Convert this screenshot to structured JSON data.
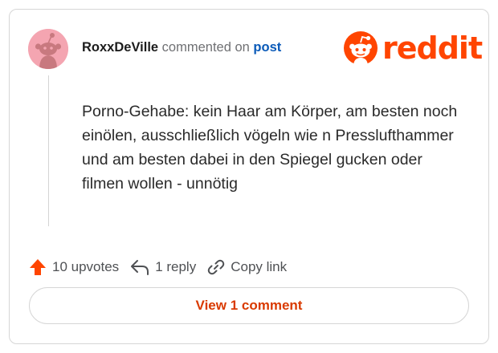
{
  "comment": {
    "username": "RoxxDeVille",
    "commented_on": "commented on",
    "post_link": "post",
    "text": "Porno-Gehabe: kein Haar am Körper, am besten noch einölen, ausschließlich vögeln wie n Presslufthammer und am besten dabei in den Spiegel gucken oder filmen wollen - unnötig"
  },
  "brand": {
    "name": "reddit",
    "color": "#ff4500"
  },
  "actions": {
    "upvotes": "10 upvotes",
    "reply": "1 reply",
    "copy_link": "Copy link"
  },
  "view_button": "View 1 comment",
  "icons": {
    "upvote": "upvote-arrow-icon",
    "reply": "reply-arrow-icon",
    "link": "link-icon",
    "snoo": "reddit-snoo-icon",
    "avatar": "snoo-avatar"
  },
  "colors": {
    "accent": "#ff4500",
    "link": "#0a5ab8",
    "avatar_bg": "#f4a5b1",
    "button_text": "#d93a00"
  }
}
